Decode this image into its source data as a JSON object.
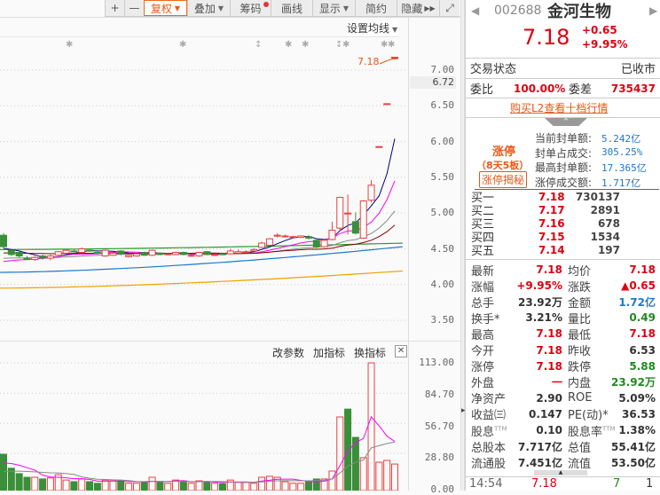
{
  "toolbar": {
    "zoom_in": "+",
    "zoom_out": "—",
    "fuquan": "复权",
    "overlay": "叠加",
    "chips": "筹码",
    "draw": "画线",
    "display": "显示",
    "simple": "简约",
    "hide": "隐藏"
  },
  "chart": {
    "ma_settings": "设置均线",
    "limit_price_label": "7.18",
    "current_price_tag": "6.72",
    "price_ticks": [
      "7.00",
      "6.50",
      "6.00",
      "5.50",
      "5.00",
      "4.50",
      "4.00",
      "3.50"
    ],
    "volume_ticks": [
      "113.00",
      "84.70",
      "56.70",
      "28.80",
      "0.00"
    ],
    "indicator_buttons": {
      "edit_params": "改参数",
      "add_indicator": "加指标",
      "switch_indicator": "换指标"
    },
    "colors": {
      "up": "#e84040",
      "down": "#3a8f3a"
    }
  },
  "chart_data": {
    "type": "candlestick",
    "price_range": [
      3.3,
      7.35
    ],
    "volume_range": [
      0,
      113
    ],
    "candles": [
      [
        4.69,
        4.53,
        4.72,
        4.5
      ],
      [
        4.48,
        4.42,
        4.5,
        4.4
      ],
      [
        4.45,
        4.4,
        4.47,
        4.38
      ],
      [
        4.37,
        4.35,
        4.4,
        4.34
      ],
      [
        4.35,
        4.38,
        4.4,
        4.33
      ],
      [
        4.4,
        4.37,
        4.42,
        4.35
      ],
      [
        4.37,
        4.4,
        4.42,
        4.34
      ],
      [
        4.41,
        4.46,
        4.47,
        4.4
      ],
      [
        4.44,
        4.48,
        4.49,
        4.43
      ],
      [
        4.47,
        4.46,
        4.49,
        4.45
      ],
      [
        4.45,
        4.5,
        4.52,
        4.44
      ],
      [
        4.48,
        4.47,
        4.5,
        4.46
      ],
      [
        4.45,
        4.44,
        4.46,
        4.43
      ],
      [
        4.4,
        4.48,
        4.49,
        4.39
      ],
      [
        4.41,
        4.44,
        4.46,
        4.4
      ],
      [
        4.47,
        4.43,
        4.48,
        4.41
      ],
      [
        4.39,
        4.41,
        4.42,
        4.38
      ],
      [
        4.4,
        4.43,
        4.44,
        4.39
      ],
      [
        4.45,
        4.41,
        4.46,
        4.4
      ],
      [
        4.41,
        4.48,
        4.49,
        4.4
      ],
      [
        4.44,
        4.42,
        4.45,
        4.41
      ],
      [
        4.42,
        4.43,
        4.44,
        4.41
      ],
      [
        4.42,
        4.45,
        4.46,
        4.41
      ],
      [
        4.45,
        4.42,
        4.46,
        4.41
      ],
      [
        4.4,
        4.41,
        4.42,
        4.39
      ],
      [
        4.4,
        4.45,
        4.46,
        4.39
      ],
      [
        4.46,
        4.42,
        4.47,
        4.41
      ],
      [
        4.41,
        4.42,
        4.43,
        4.4
      ],
      [
        4.43,
        4.42,
        4.44,
        4.41
      ],
      [
        4.43,
        4.47,
        4.5,
        4.42
      ],
      [
        4.44,
        4.46,
        4.49,
        4.43
      ],
      [
        4.45,
        4.46,
        4.48,
        4.44
      ],
      [
        4.47,
        4.49,
        4.51,
        4.46
      ],
      [
        4.52,
        4.58,
        4.6,
        4.51
      ],
      [
        4.55,
        4.64,
        4.65,
        4.54
      ],
      [
        4.69,
        4.69,
        4.72,
        4.66
      ],
      [
        4.68,
        4.68,
        4.7,
        4.66
      ],
      [
        4.66,
        4.67,
        4.68,
        4.65
      ],
      [
        4.66,
        4.68,
        4.69,
        4.65
      ],
      [
        4.67,
        4.65,
        4.69,
        4.63
      ],
      [
        4.62,
        4.53,
        4.63,
        4.51
      ],
      [
        4.53,
        4.62,
        4.63,
        4.52
      ],
      [
        4.63,
        4.76,
        4.88,
        4.62
      ],
      [
        4.79,
        5.22,
        5.23,
        4.75
      ],
      [
        5.0,
        5.0,
        5.26,
        4.7
      ],
      [
        4.88,
        4.72,
        5.01,
        4.7
      ],
      [
        4.65,
        5.17,
        5.18,
        4.64
      ],
      [
        5.18,
        5.39,
        5.46,
        5.15
      ],
      [
        5.93,
        5.93,
        5.93,
        5.93
      ],
      [
        6.53,
        6.53,
        6.53,
        6.53
      ],
      [
        7.18,
        7.18,
        7.18,
        7.18
      ]
    ],
    "volumes": [
      28,
      15,
      10,
      6.6,
      6.6,
      5,
      6,
      9,
      4,
      2.5,
      5,
      2.5,
      1,
      4,
      3.3,
      3.3,
      1,
      1,
      2,
      6.6,
      2.5,
      1,
      4,
      3.3,
      1,
      3.3,
      2,
      1,
      0.5,
      4,
      2,
      2,
      1,
      6.6,
      7.5,
      6.6,
      2.5,
      1,
      1,
      2.5,
      5,
      5,
      12.4,
      62.7,
      70,
      43.7,
      24.8,
      113,
      20.6,
      22.3,
      18.9
    ],
    "extra_ma": [
      {
        "name": "MA-green",
        "color": "#2a9a2a",
        "start": 4.49,
        "end": 4.58
      },
      {
        "name": "MA-blue",
        "color": "#1a78d0",
        "start": 4.17,
        "end": 4.53
      },
      {
        "name": "MA-orange",
        "color": "#f0a000",
        "start": 3.95,
        "end": 4.19
      }
    ]
  },
  "stock": {
    "code": "002688",
    "name": "金河生物",
    "price": "7.18",
    "change": "+0.65",
    "change_pct": "+9.95%",
    "status_label": "交易状态",
    "status_value": "已收市",
    "wb_label": "委比",
    "wb_value": "100.00%",
    "wc_label": "委差",
    "wc_value": "735437",
    "l2_link": "购买L2查看十档行情"
  },
  "limit_up": {
    "title": "涨停",
    "streak": "（8天5板）",
    "button": "涨停揭秘",
    "rows": [
      {
        "label": "当前封单额:",
        "value": "5.242亿"
      },
      {
        "label": "封单占成交:",
        "value": "305.25%"
      },
      {
        "label": "最高封单额:",
        "value": "17.365亿"
      },
      {
        "label": "涨停成交额:",
        "value": "1.717亿"
      }
    ]
  },
  "bids": [
    {
      "label": "买一",
      "price": "7.18",
      "vol": "730137"
    },
    {
      "label": "买二",
      "price": "7.17",
      "vol": "2891"
    },
    {
      "label": "买三",
      "price": "7.16",
      "vol": "678"
    },
    {
      "label": "买四",
      "price": "7.15",
      "vol": "1534"
    },
    {
      "label": "买五",
      "price": "7.14",
      "vol": "197"
    }
  ],
  "stats": [
    {
      "l1": "最新",
      "v1": "7.18",
      "c1": "red",
      "l2": "均价",
      "v2": "7.18",
      "c2": "red"
    },
    {
      "l1": "涨幅",
      "v1": "+9.95%",
      "c1": "red",
      "l2": "涨跌",
      "v2": "▲0.65",
      "c2": "red"
    },
    {
      "l1": "总手",
      "v1": "23.92万",
      "c1": "dark",
      "l2": "金额",
      "v2": "1.72亿",
      "c2": "blue"
    },
    {
      "l1": "换手*",
      "v1": "3.21%",
      "c1": "dark",
      "l2": "量比",
      "v2": "0.49",
      "c2": "green"
    },
    {
      "l1": "最高",
      "v1": "7.18",
      "c1": "red",
      "l2": "最低",
      "v2": "7.18",
      "c2": "red"
    },
    {
      "l1": "今开",
      "v1": "7.18",
      "c1": "red",
      "l2": "昨收",
      "v2": "6.53",
      "c2": "dark"
    },
    {
      "l1": "涨停",
      "v1": "7.18",
      "c1": "red",
      "l2": "跌停",
      "v2": "5.88",
      "c2": "green"
    },
    {
      "l1": "外盘",
      "v1": "一",
      "c1": "red",
      "l2": "内盘",
      "v2": "23.92万",
      "c2": "green"
    },
    {
      "l1": "净资产",
      "v1": "2.90",
      "c1": "dark",
      "l2": "ROE",
      "v2": "5.09%",
      "c2": "dark"
    },
    {
      "l1": "收益㈢",
      "v1": "0.147",
      "c1": "dark",
      "l2": "PE(动)*",
      "v2": "36.53",
      "c2": "dark"
    },
    {
      "l1": "股息",
      "s1": "TTM",
      "v1": "0.10",
      "c1": "dark",
      "l2": "股息率",
      "s2": "TTM",
      "v2": "1.38%",
      "c2": "dark"
    },
    {
      "l1": "总股本",
      "v1": "7.717亿",
      "c1": "dark",
      "l2": "总值",
      "v2": "55.41亿",
      "c2": "dark"
    },
    {
      "l1": "流通股",
      "v1": "7.451亿",
      "c1": "dark",
      "l2": "流值",
      "v2": "53.50亿",
      "c2": "dark"
    }
  ],
  "tick": {
    "time": "14:54",
    "price": "7.18",
    "vol": "7",
    "count": "1"
  }
}
